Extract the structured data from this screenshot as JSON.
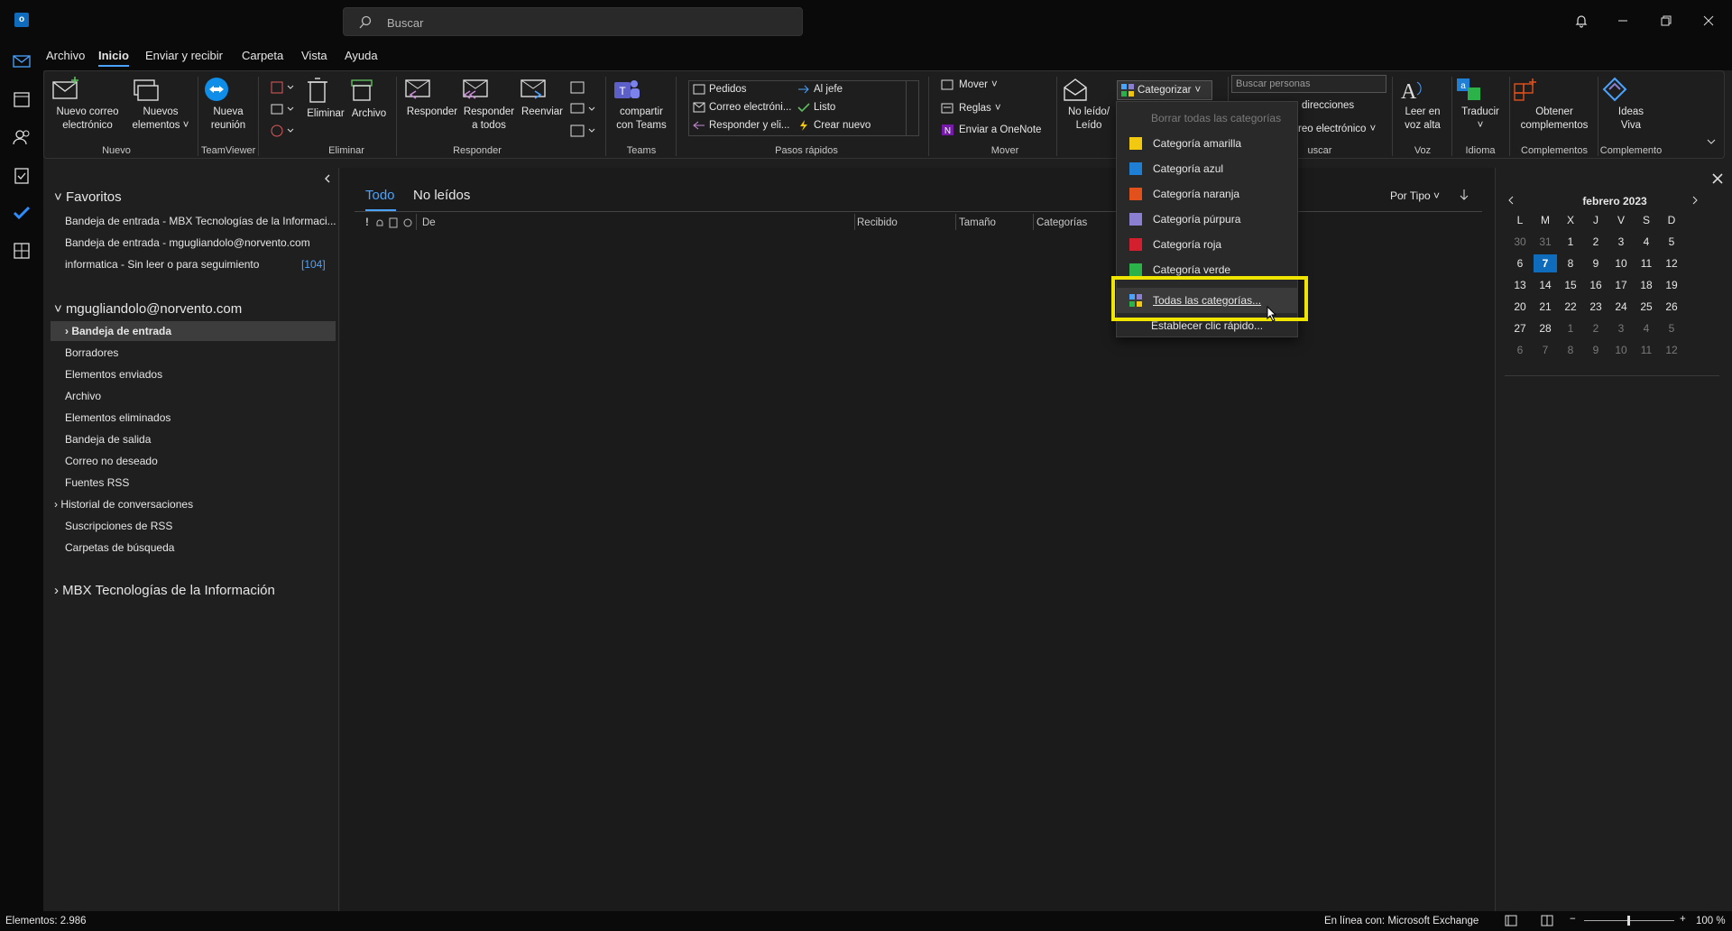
{
  "search": {
    "placeholder": "Buscar"
  },
  "tabs": [
    "Archivo",
    "Inicio",
    "Enviar y recibir",
    "Carpeta",
    "Vista",
    "Ayuda"
  ],
  "ribbon": {
    "new_mail": [
      "Nuevo correo",
      "electrónico"
    ],
    "new_items": [
      "Nuevos",
      "elementos"
    ],
    "new_meeting": [
      "Nueva",
      "reunión"
    ],
    "delete": "Eliminar",
    "archive": "Archivo",
    "reply": "Responder",
    "reply_all": [
      "Responder",
      "a todos"
    ],
    "forward": "Reenviar",
    "share_teams": [
      "compartir",
      "con Teams"
    ],
    "quick_steps": [
      "Pedidos",
      "Correo electróni...",
      "Responder y eli...",
      "Al jefe",
      "Listo",
      "Crear nuevo"
    ],
    "move": "Mover",
    "rules": "Reglas",
    "onenote": "Enviar a OneNote",
    "unread": [
      "No leído/",
      "Leído"
    ],
    "categorize": "Categorizar",
    "search_people": "Buscar personas",
    "address": "direcciones",
    "email_filter": "reo electrónico",
    "read_aloud": [
      "Leer en",
      "voz alta"
    ],
    "translate": "Traducir",
    "addins": [
      "Obtener",
      "complementos"
    ],
    "ideas": [
      "Ideas",
      "Viva"
    ],
    "groups": [
      "Nuevo",
      "TeamViewer",
      "Eliminar",
      "Responder",
      "Teams",
      "Pasos rápidos",
      "Mover",
      "uscar",
      "Voz",
      "Idioma",
      "Complementos",
      "Complemento"
    ]
  },
  "folders": {
    "favorites_title": "Favoritos",
    "favorites": [
      "Bandeja de entrada - MBX Tecnologías de la Informaci...",
      "Bandeja de entrada - mgugliandolo@norvento.com",
      "informatica - Sin leer o para seguimiento"
    ],
    "favorites_badge": "[104]",
    "account": "mgugliandolo@norvento.com",
    "items": [
      "Bandeja de entrada",
      "Borradores",
      "Elementos enviados",
      "Archivo",
      "Elementos eliminados",
      "Bandeja de salida",
      "Correo no deseado",
      "Fuentes RSS",
      "Historial de conversaciones",
      "Suscripciones de RSS",
      "Carpetas de búsqueda"
    ],
    "account2": "MBX Tecnologías de la Información"
  },
  "maillist": {
    "tab_all": "Todo",
    "tab_unread": "No leídos",
    "sort": "Por Tipo",
    "columns": [
      "!",
      "De",
      "Recibido",
      "Tamaño",
      "Categorías"
    ]
  },
  "calendar": {
    "month": "febrero 2023",
    "weekdays": [
      "L",
      "M",
      "X",
      "J",
      "V",
      "S",
      "D"
    ],
    "weeks": [
      [
        "30",
        "31",
        "1",
        "2",
        "3",
        "4",
        "5"
      ],
      [
        "6",
        "7",
        "8",
        "9",
        "10",
        "11",
        "12"
      ],
      [
        "13",
        "14",
        "15",
        "16",
        "17",
        "18",
        "19"
      ],
      [
        "20",
        "21",
        "22",
        "23",
        "24",
        "25",
        "26"
      ],
      [
        "27",
        "28",
        "1",
        "2",
        "3",
        "4",
        "5"
      ],
      [
        "6",
        "7",
        "8",
        "9",
        "10",
        "11",
        "12"
      ]
    ],
    "today": "7"
  },
  "category_menu": {
    "clear": "Borrar todas las categorías",
    "items": [
      {
        "label": "Categoría amarilla",
        "color": "#f2c811"
      },
      {
        "label": "Categoría azul",
        "color": "#1e7fd4"
      },
      {
        "label": "Categoría naranja",
        "color": "#e2501c"
      },
      {
        "label": "Categoría púrpura",
        "color": "#8a7fd1"
      },
      {
        "label": "Categoría roja",
        "color": "#d4202e"
      },
      {
        "label": "Categoría verde",
        "color": "#2bb34a"
      }
    ],
    "all": "Todas las categorías...",
    "quick": "Establecer clic rápido..."
  },
  "status": {
    "items": "Elementos: 2.986",
    "connection": "En línea con: Microsoft Exchange",
    "zoom": "100 %"
  },
  "colors": {
    "accent": "#0f6cbd",
    "highlight": "#f0e500"
  }
}
